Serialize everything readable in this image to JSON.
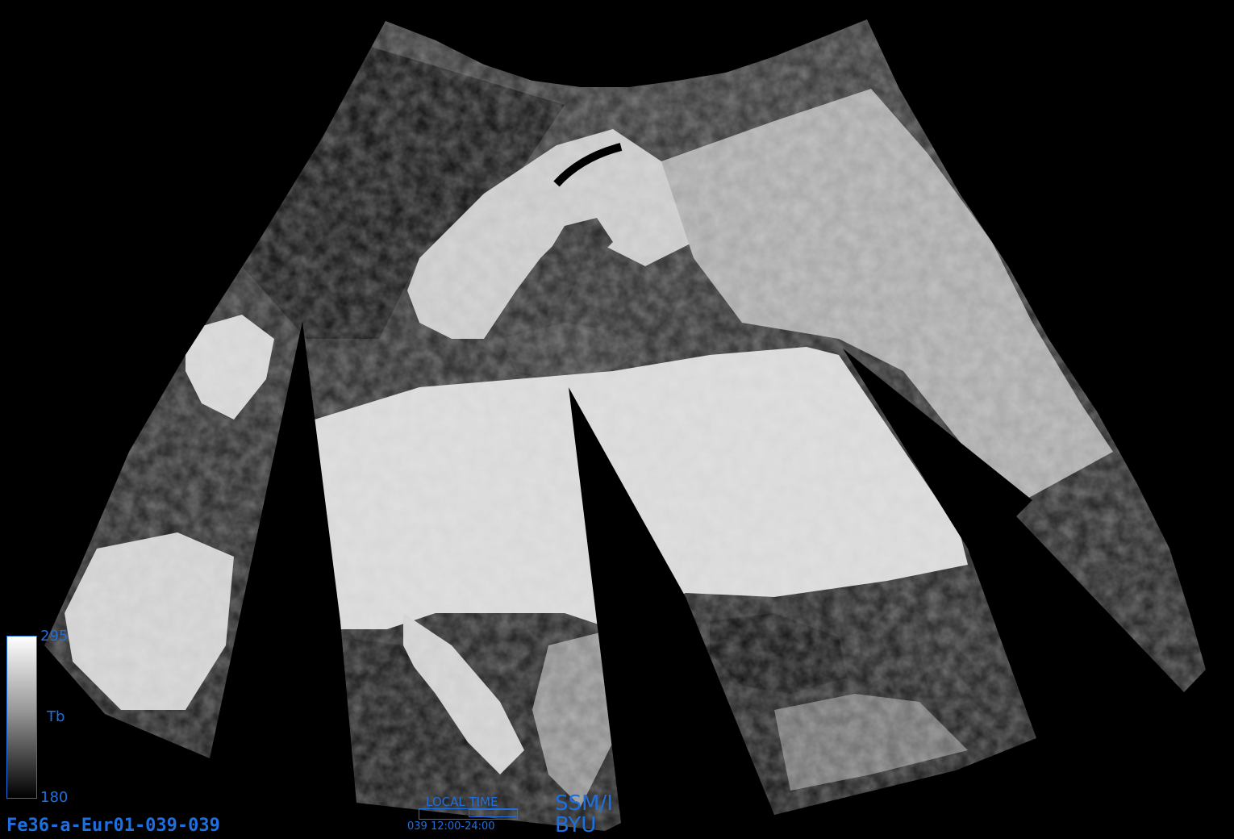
{
  "image": {
    "background_color": "#000000",
    "annotation_color": "#1e6fe0",
    "scene": "grayscale passive-microwave brightness temperature swaths over Europe"
  },
  "product_id": "Fe36-a-Eur01-039-039",
  "colorbar": {
    "max_label": "295",
    "min_label": "180",
    "variable_label": "Tb"
  },
  "local_time": {
    "label": "LOCAL TIME",
    "range_text": "039  12:00-24:00",
    "filled_fraction": 0.5
  },
  "sensor": {
    "name": "SSM/I",
    "institution": "BYU"
  }
}
